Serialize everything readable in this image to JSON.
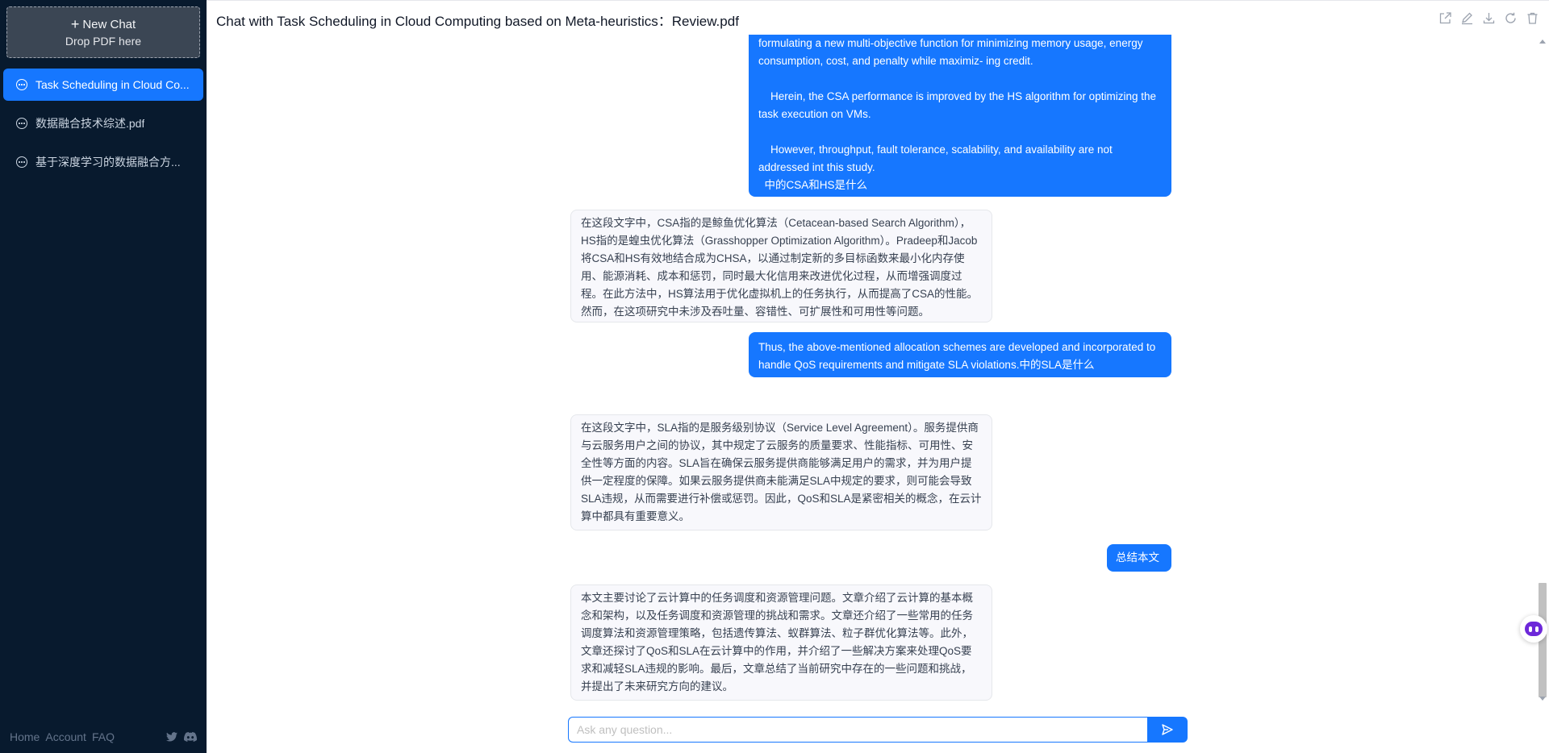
{
  "sidebar": {
    "new_chat": {
      "label": "New Chat",
      "drop_hint": "Drop PDF here"
    },
    "chats": [
      {
        "label": "Task Scheduling in Cloud Co...",
        "active": true
      },
      {
        "label": "数据融合技术综述.pdf",
        "active": false
      },
      {
        "label": "基于深度学习的数据融合方...",
        "active": false
      }
    ],
    "footer": {
      "links": [
        "Home",
        "Account",
        "FAQ"
      ],
      "social_icons": [
        "twitter-icon",
        "discord-icon"
      ]
    }
  },
  "header": {
    "title": "Chat with Task Scheduling in Cloud Computing based on Meta-heuristics：Review.pdf",
    "actions": [
      "share-icon",
      "edit-icon",
      "download-icon",
      "reload-icon",
      "trash-icon"
    ]
  },
  "messages": [
    {
      "role": "user",
      "text": "formulating a new multi-objective function for minimizing memory usage, energy consumption, cost, and penalty while maximiz- ing credit.\n\n    Herein, the CSA performance is improved by the HS algorithm for optimizing the task execution on VMs.\n\n    However, throughput, fault tolerance, scalability, and availability are not addressed int this study.\n  中的CSA和HS是什么"
    },
    {
      "role": "assistant",
      "text": "在这段文字中，CSA指的是鲸鱼优化算法（Cetacean-based Search Algorithm），HS指的是蝗虫优化算法（Grasshopper Optimization Algorithm）。Pradeep和Jacob将CSA和HS有效地结合成为CHSA，以通过制定新的多目标函数来最小化内存使用、能源消耗、成本和惩罚，同时最大化信用来改进优化过程，从而增强调度过程。在此方法中，HS算法用于优化虚拟机上的任务执行，从而提高了CSA的性能。然而，在这项研究中未涉及吞吐量、容错性、可扩展性和可用性等问题。"
    },
    {
      "role": "user",
      "text": "Thus, the above-mentioned allocation schemes are developed and incorporated to handle QoS requirements and mitigate SLA violations.中的SLA是什么"
    },
    {
      "role": "assistant",
      "text": "在这段文字中，SLA指的是服务级别协议（Service Level Agreement）。服务提供商与云服务用户之间的协议，其中规定了云服务的质量要求、性能指标、可用性、安全性等方面的内容。SLA旨在确保云服务提供商能够满足用户的需求，并为用户提供一定程度的保障。如果云服务提供商未能满足SLA中规定的要求，则可能会导致SLA违规，从而需要进行补偿或惩罚。因此，QoS和SLA是紧密相关的概念，在云计算中都具有重要意义。"
    },
    {
      "role": "user",
      "text": "总结本文"
    },
    {
      "role": "assistant",
      "text": "本文主要讨论了云计算中的任务调度和资源管理问题。文章介绍了云计算的基本概念和架构，以及任务调度和资源管理的挑战和需求。文章还介绍了一些常用的任务调度算法和资源管理策略，包括遗传算法、蚁群算法、粒子群优化算法等。此外，文章还探讨了QoS和SLA在云计算中的作用，并介绍了一些解决方案来处理QoS要求和减轻SLA违规的影响。最后，文章总结了当前研究中存在的一些问题和挑战，并提出了未来研究方向的建议。"
    }
  ],
  "input": {
    "placeholder": "Ask any question..."
  },
  "colors": {
    "accent": "#1677ff",
    "sidebar_bg": "#081a2e"
  }
}
